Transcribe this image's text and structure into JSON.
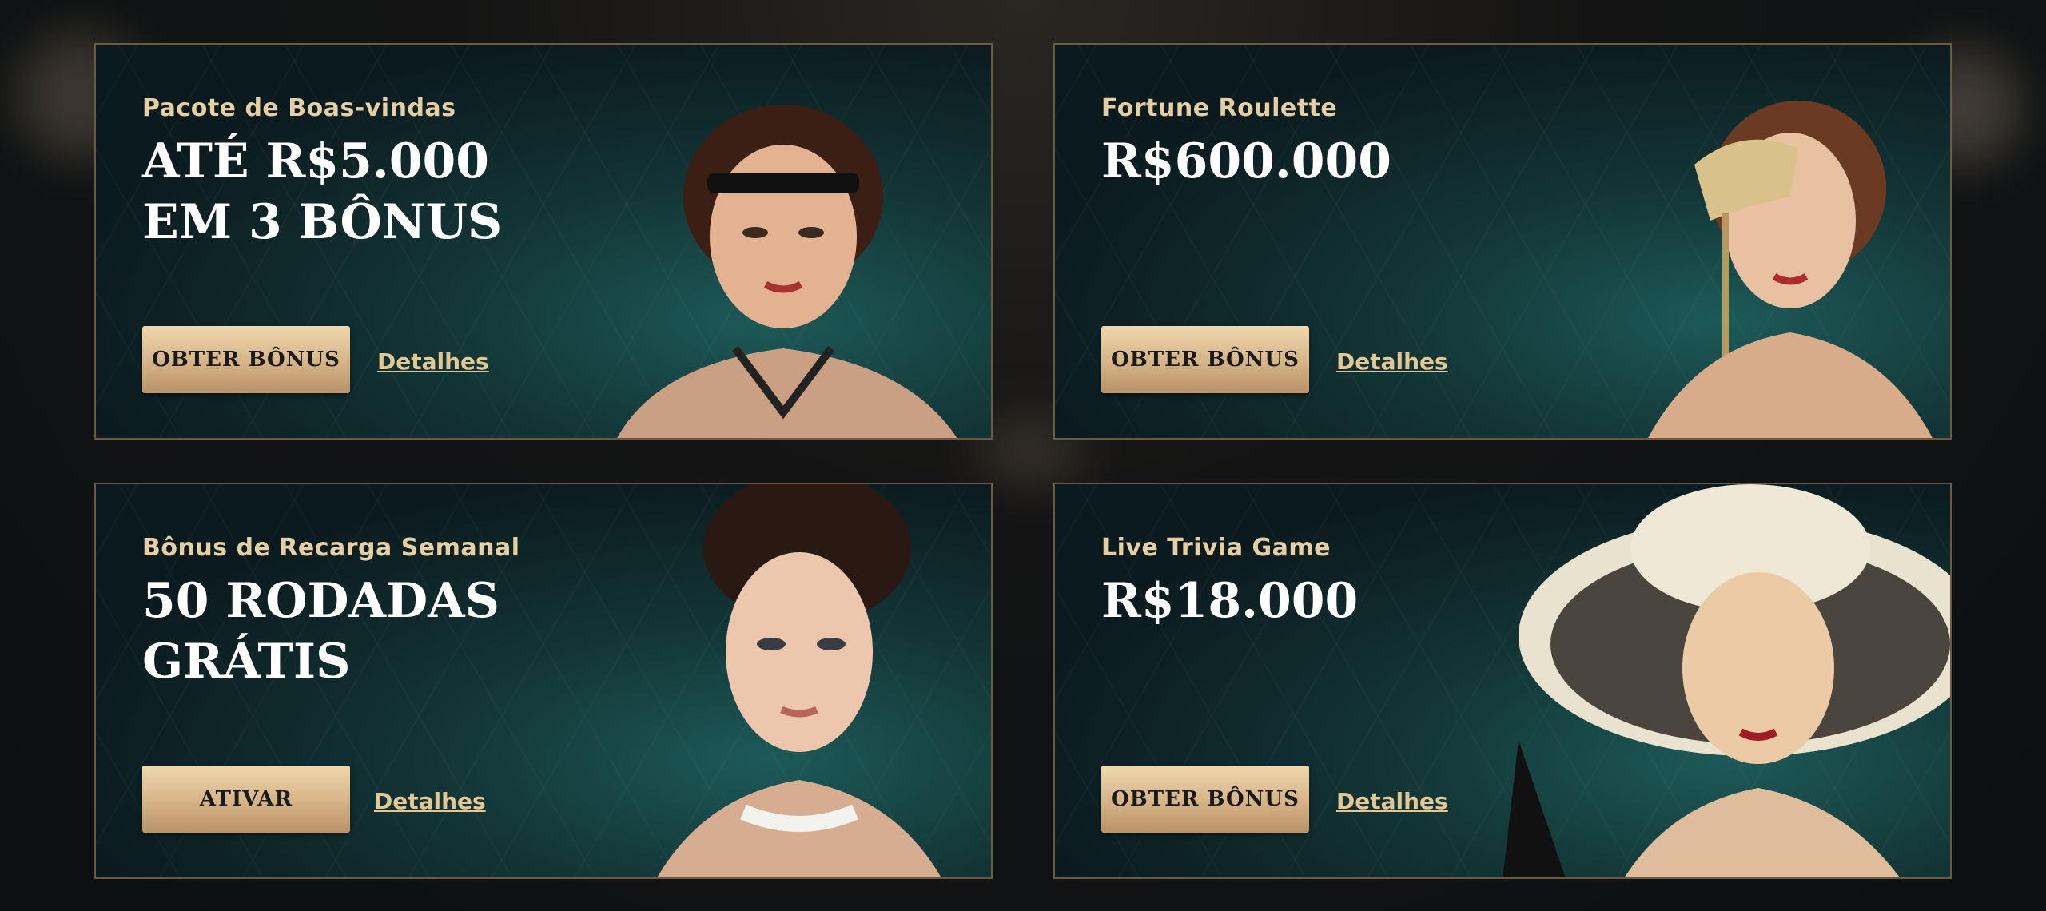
{
  "cards": [
    {
      "subtitle": "Pacote de Boas-vindas",
      "headline_line1": "ATÉ R$5.000",
      "headline_line2": "EM 3 BÔNUS",
      "button": "OBTER BÔNUS",
      "details": "Detalhes"
    },
    {
      "subtitle": "Fortune Roulette",
      "headline_line1": "R$600.000",
      "headline_line2": "",
      "button": "OBTER BÔNUS",
      "details": "Detalhes"
    },
    {
      "subtitle": "Bônus de Recarga Semanal",
      "headline_line1": "50 RODADAS",
      "headline_line2": "GRÁTIS",
      "button": "ATIVAR",
      "details": "Detalhes"
    },
    {
      "subtitle": "Live Trivia Game",
      "headline_line1": "R$18.000",
      "headline_line2": "",
      "button": "OBTER BÔNUS",
      "details": "Detalhes"
    }
  ],
  "colors": {
    "accent_gold": "#e4c894",
    "button_gradient_top": "#f0d7ae",
    "button_gradient_bottom": "#b89268",
    "card_teal": "#1d5a58",
    "page_bg": "#0c1013"
  }
}
